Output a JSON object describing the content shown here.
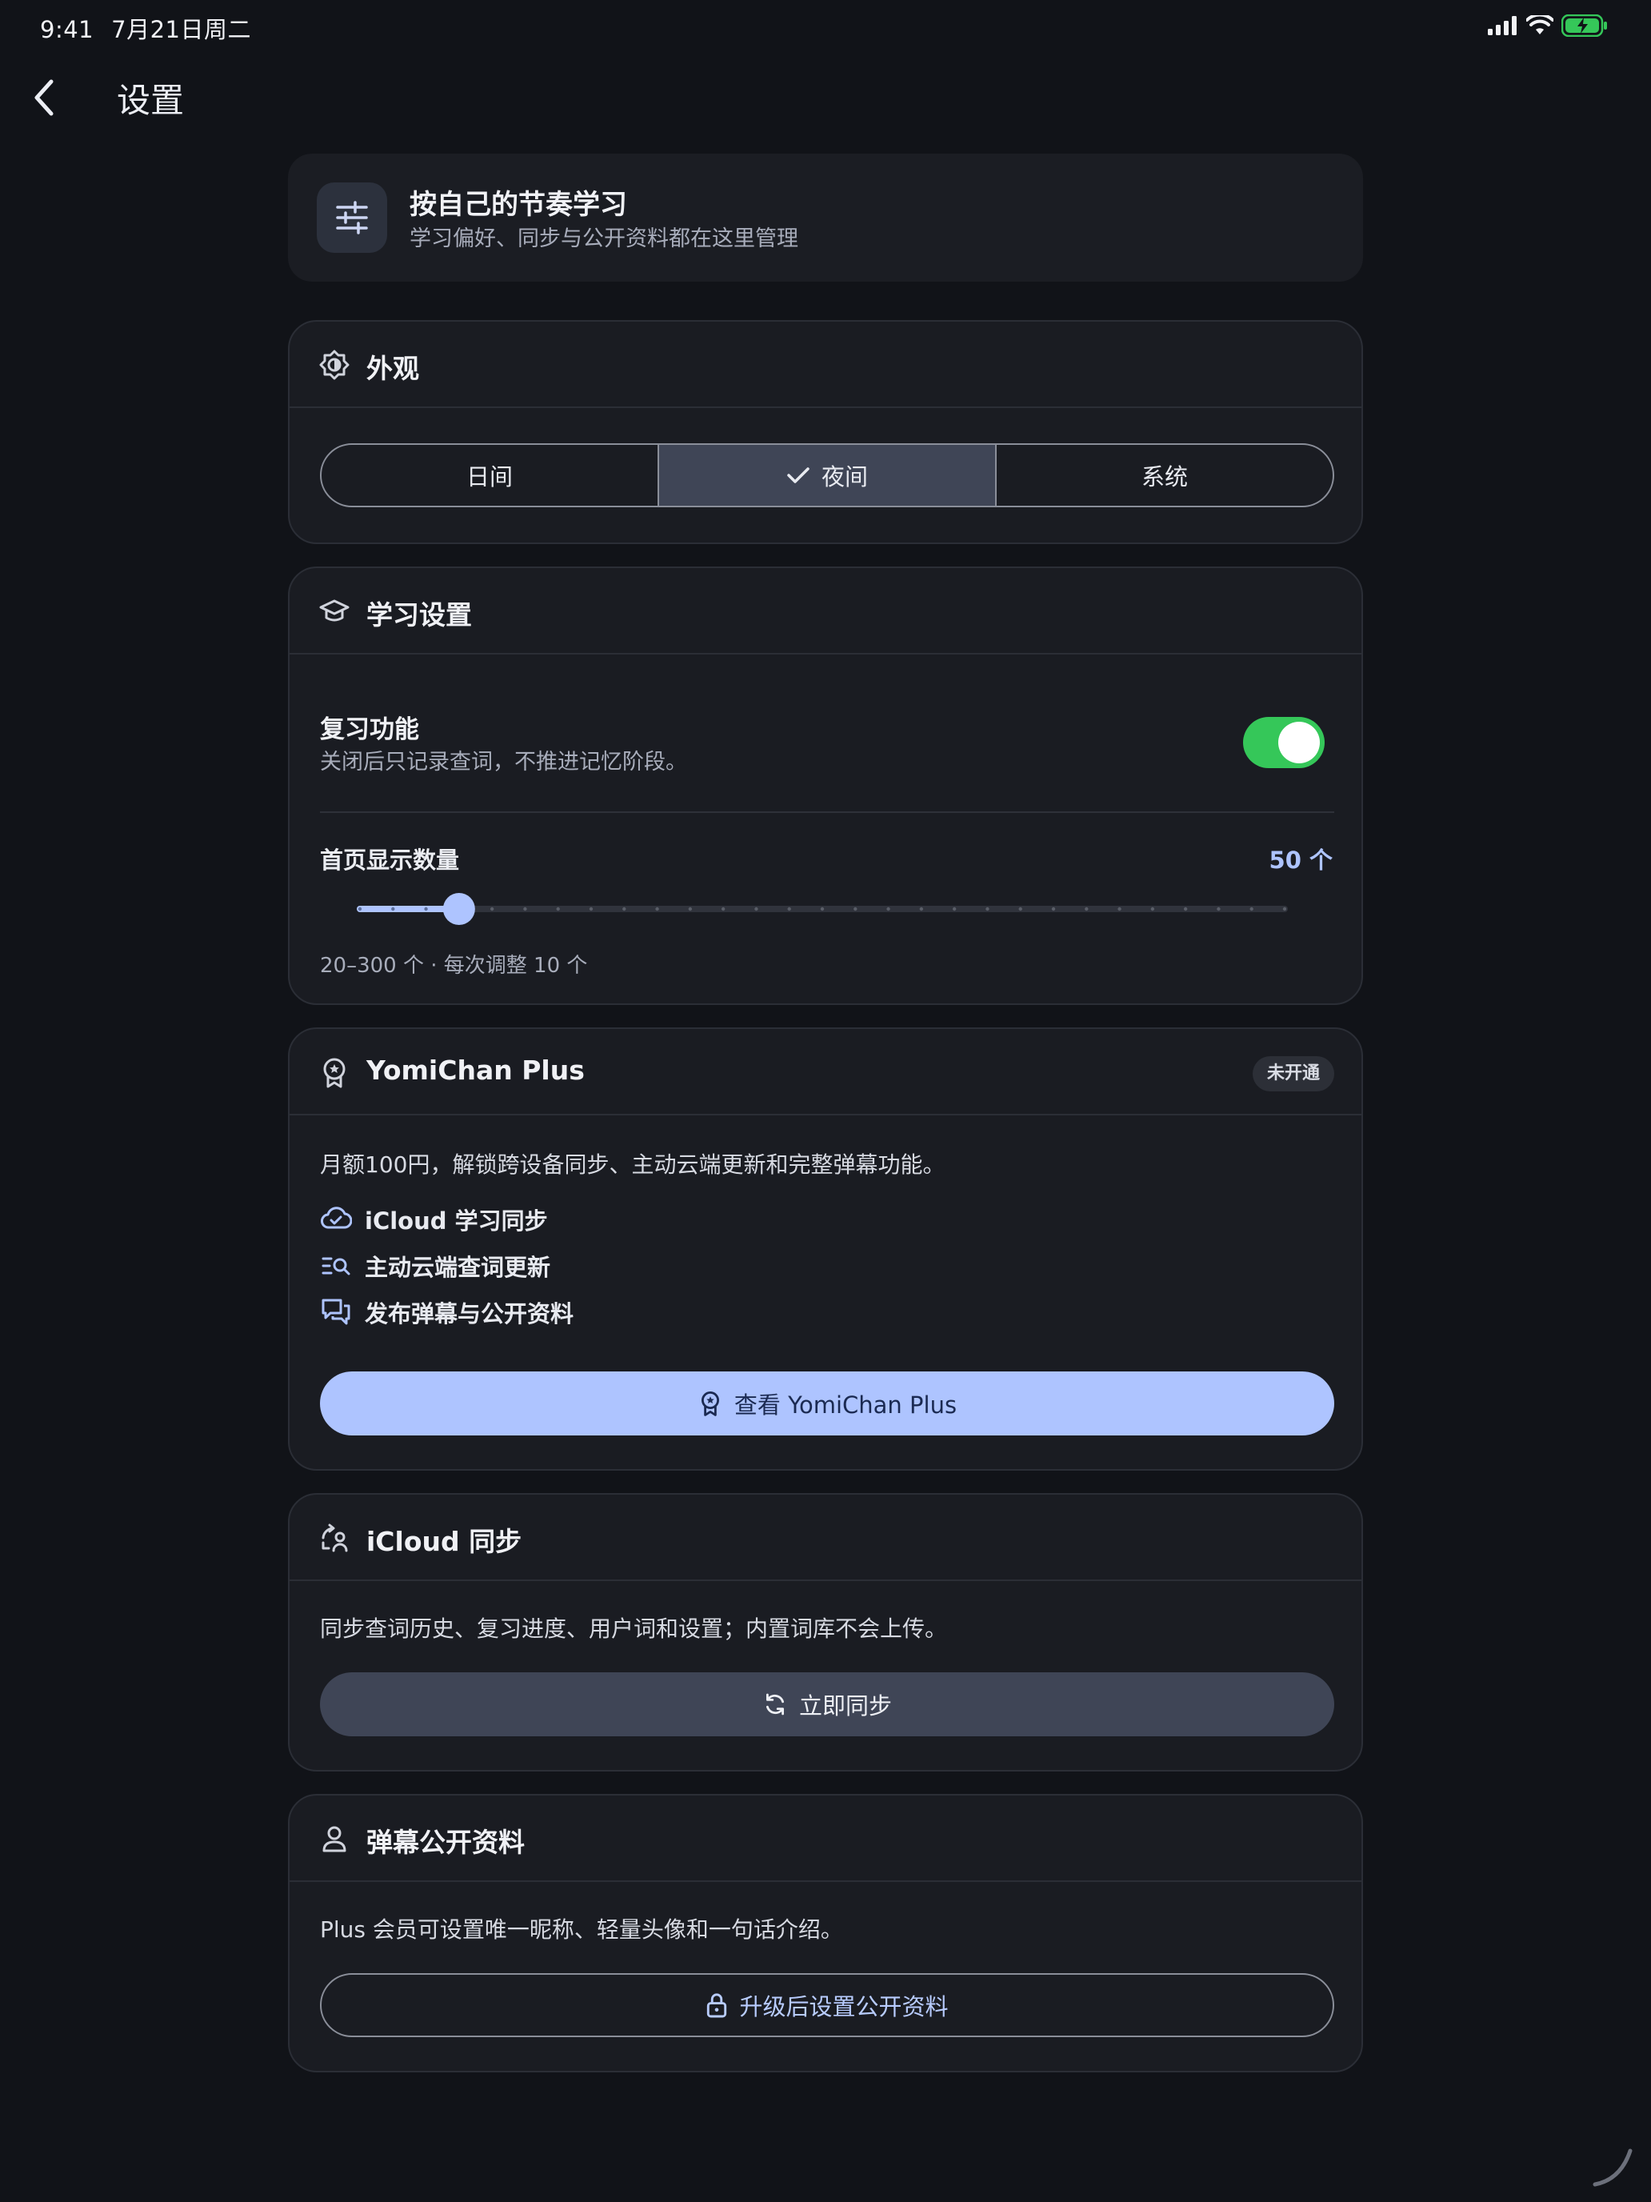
{
  "status_bar": {
    "time": "9:41",
    "date": "7月21日周二"
  },
  "nav": {
    "title": "设置"
  },
  "intro": {
    "title": "按自己的节奏学习",
    "subtitle": "学习偏好、同步与公开资料都在这里管理"
  },
  "appearance": {
    "title": "外观",
    "options": [
      {
        "label": "日间",
        "selected": false
      },
      {
        "label": "夜间",
        "selected": true
      },
      {
        "label": "系统",
        "selected": false
      }
    ]
  },
  "learning": {
    "title": "学习设置",
    "review": {
      "title": "复习功能",
      "description": "关闭后只记录查词，不推进记忆阶段。",
      "enabled": true
    },
    "home_count": {
      "label": "首页显示数量",
      "value_text": "50 个",
      "value": 50,
      "min": 20,
      "max": 300,
      "step": 10,
      "hint": "20–300 个 · 每次调整 10 个"
    }
  },
  "plus": {
    "title": "YomiChan Plus",
    "badge": "未开通",
    "description": "月额100円，解锁跨设备同步、主动云端更新和完整弹幕功能。",
    "features": [
      {
        "icon": "cloud-check-icon",
        "label": "iCloud 学习同步"
      },
      {
        "icon": "list-search-icon",
        "label": "主动云端查词更新"
      },
      {
        "icon": "chat-bubbles-icon",
        "label": "发布弹幕与公开资料"
      }
    ],
    "button_label": "查看 YomiChan Plus"
  },
  "icloud": {
    "title": "iCloud 同步",
    "description": "同步查词历史、复习进度、用户词和设置；内置词库不会上传。",
    "button_label": "立即同步"
  },
  "profile": {
    "title": "弹幕公开资料",
    "description": "Plus 会员可设置唯一昵称、轻量头像和一句话介绍。",
    "button_label": "升级后设置公开资料"
  },
  "colors": {
    "background": "#111318",
    "card": "#1a1c22",
    "accent": "#aec4ff",
    "toggle_on": "#35c759",
    "segment_active": "#3f4556"
  }
}
